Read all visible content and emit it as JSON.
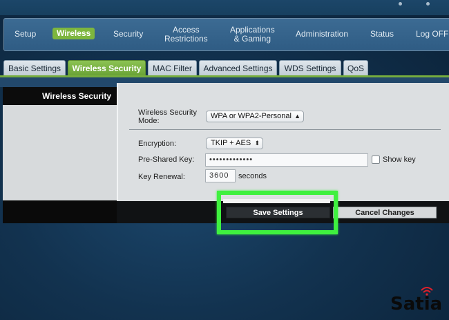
{
  "nav": {
    "items": [
      {
        "label": "Setup"
      },
      {
        "label": "Wireless"
      },
      {
        "label": "Security"
      },
      {
        "label": "Access\nRestrictions"
      },
      {
        "label": "Applications\n& Gaming"
      },
      {
        "label": "Administration"
      },
      {
        "label": "Status"
      },
      {
        "label": "Log OFF"
      }
    ],
    "active_color": "#7db63e"
  },
  "subtabs": [
    {
      "label": "Basic Settings"
    },
    {
      "label": "Wireless Security"
    },
    {
      "label": "MAC Filter"
    },
    {
      "label": "Advanced Settings"
    },
    {
      "label": "WDS Settings"
    },
    {
      "label": "QoS"
    }
  ],
  "sidebar": {
    "title": "Wireless Security"
  },
  "form": {
    "mode_label": "Wireless Security\nMode:",
    "mode_value": "WPA or WPA2-Personal",
    "encryption_label": "Encryption:",
    "encryption_value": "TKIP + AES",
    "psk_label": "Pre-Shared Key:",
    "psk_value": "•••••••••••••",
    "show_key_label": "Show key",
    "renewal_label": "Key Renewal:",
    "renewal_value": "3600",
    "renewal_unit": "seconds"
  },
  "buttons": {
    "save_label": "Save Settings",
    "cancel_label": "Cancel Changes"
  },
  "highlight_color": "#3ff03f",
  "watermark": {
    "text": "Satia",
    "icon": "wifi-icon",
    "icon_color": "#e0202a"
  }
}
